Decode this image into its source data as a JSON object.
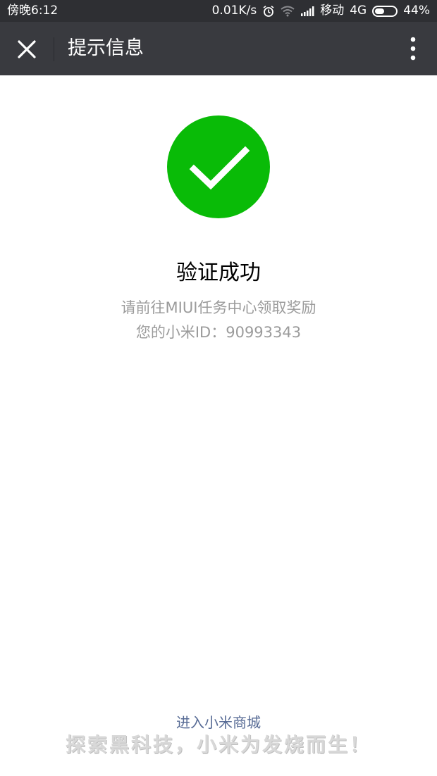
{
  "status_bar": {
    "time": "傍晚6:12",
    "network_speed": "0.01K/s",
    "carrier": "移动",
    "network_type": "4G",
    "battery": "44%",
    "icons": [
      "alarm-icon",
      "wifi-icon",
      "signal-icon",
      "battery-icon"
    ]
  },
  "app_bar": {
    "title": "提示信息",
    "close_icon": "close-icon",
    "more_icon": "more-vertical-icon"
  },
  "content": {
    "status_icon": "check-circle-icon",
    "accent_color": "#09bb07",
    "heading": "验证成功",
    "line1": "请前往MIUI任务中心领取奖励",
    "line2": "您的小米ID：90993343"
  },
  "footer": {
    "link": "进入小米商城",
    "watermark": "探索黑科技，小米为发烧而生！"
  }
}
